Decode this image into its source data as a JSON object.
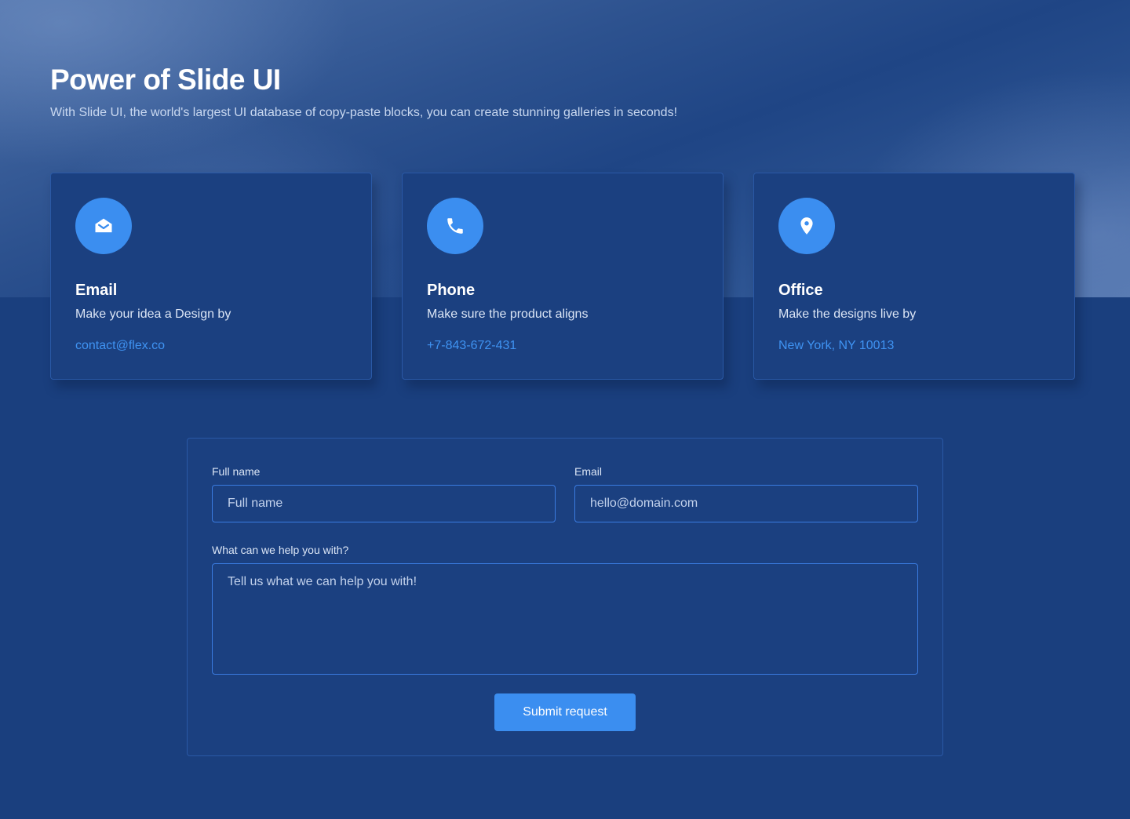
{
  "hero": {
    "title": "Power of Slide UI",
    "subtitle": "With Slide UI, the world's largest UI database of copy-paste blocks, you can create stunning galleries in seconds!"
  },
  "cards": [
    {
      "icon": "envelope-open-icon",
      "title": "Email",
      "description": "Make your idea a Design by",
      "link": "contact@flex.co"
    },
    {
      "icon": "phone-icon",
      "title": "Phone",
      "description": "Make sure the product aligns",
      "link": "+7-843-672-431"
    },
    {
      "icon": "map-pin-icon",
      "title": "Office",
      "description": "Make the designs live by",
      "link": "New York, NY 10013"
    }
  ],
  "form": {
    "full_name_label": "Full name",
    "full_name_placeholder": "Full name",
    "email_label": "Email",
    "email_placeholder": "hello@domain.com",
    "message_label": "What can we help you with?",
    "message_placeholder": "Tell us what we can help you with!",
    "submit_label": "Submit request"
  },
  "colors": {
    "background": "#1a3f7e",
    "card": "#1b4080",
    "accent": "#3b8ef0",
    "link": "#3f93f2"
  }
}
